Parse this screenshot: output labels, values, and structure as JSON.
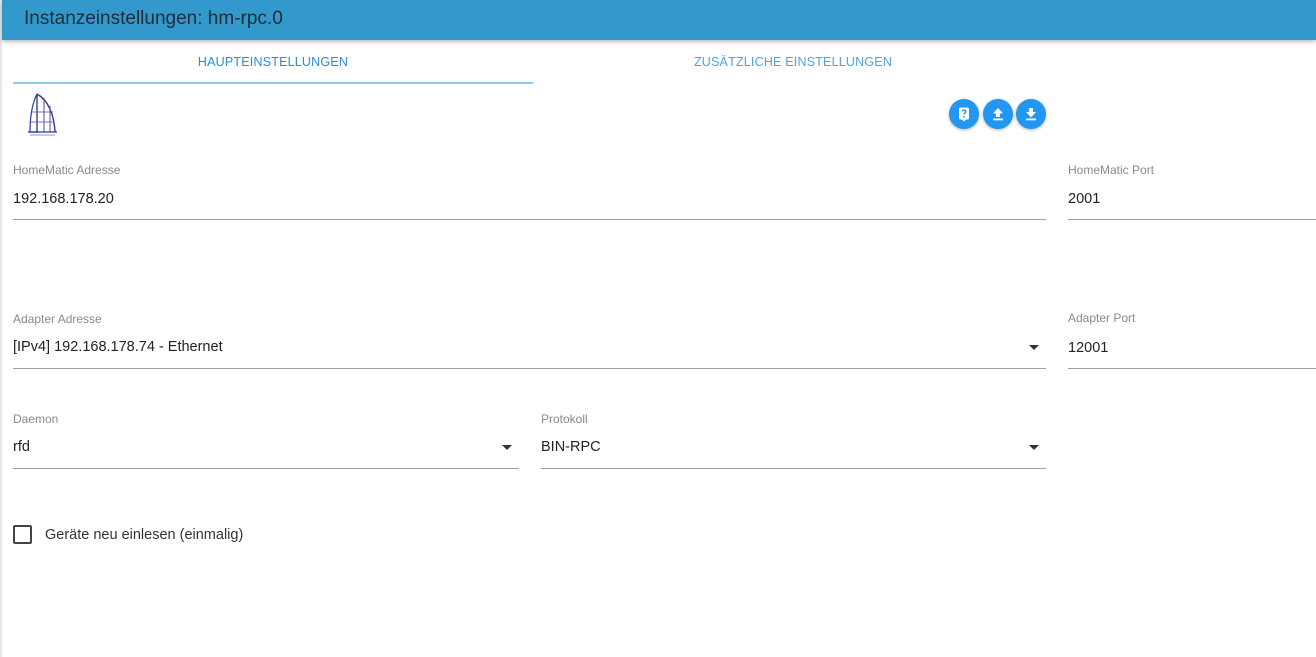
{
  "window": {
    "title": "Instanzeinstellungen: hm-rpc.0"
  },
  "tabs": [
    {
      "label": "HAUPTEINSTELLUNGEN",
      "active": true
    },
    {
      "label": "ZUSÄTZLICHE EINSTELLUNGEN",
      "active": false
    }
  ],
  "toolbar": {
    "icons": [
      "help-icon",
      "upload-icon",
      "download-icon"
    ]
  },
  "logo": {
    "icon": "homematic-logo"
  },
  "fields": {
    "homematic_address": {
      "label": "HomeMatic Adresse",
      "value": "192.168.178.20"
    },
    "homematic_port": {
      "label": "HomeMatic Port",
      "value": "2001"
    },
    "adapter_address": {
      "label": "Adapter Adresse",
      "value": "[IPv4] 192.168.178.74 - Ethernet"
    },
    "adapter_port": {
      "label": "Adapter Port",
      "value": "12001"
    },
    "daemon": {
      "label": "Daemon",
      "value": "rfd"
    },
    "protocol": {
      "label": "Protokoll",
      "value": "BIN-RPC"
    }
  },
  "checkbox": {
    "label": "Geräte neu einlesen (einmalig)",
    "checked": false
  },
  "colors": {
    "titlebar": "#3399cc",
    "accent": "#2196f3",
    "tab_text": "#2b8dd6"
  }
}
